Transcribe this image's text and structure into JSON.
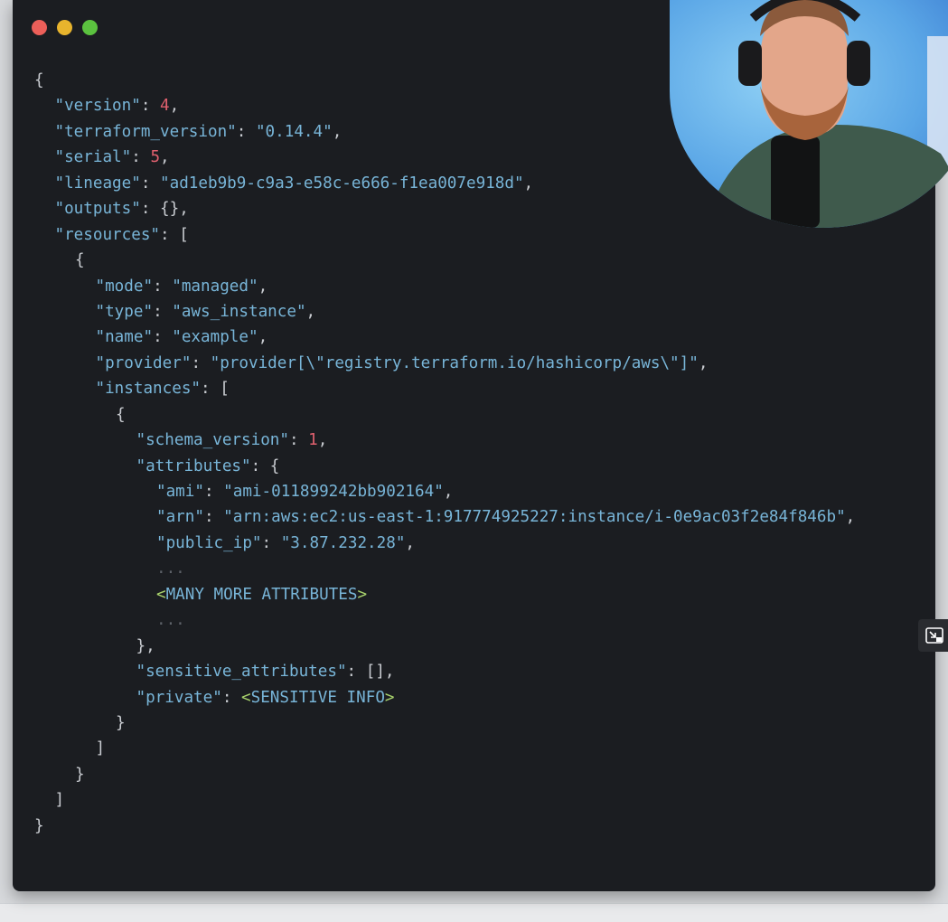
{
  "window": {
    "traffic_lights": [
      {
        "name": "close",
        "color": "#ec5f59"
      },
      {
        "name": "minimize",
        "color": "#e8b42d"
      },
      {
        "name": "maximize",
        "color": "#5bc23f"
      }
    ]
  },
  "colors": {
    "background": "#1b1d21",
    "key_string": "#78b5d8",
    "number": "#e0606e",
    "punctuation": "#c9ccd1",
    "placeholder_brackets": "#a8d26c",
    "ellipsis": "#5d6168"
  },
  "code": {
    "open_brace": "{",
    "version_key": "\"version\"",
    "version_val": "4",
    "tf_version_key": "\"terraform_version\"",
    "tf_version_val": "\"0.14.4\"",
    "serial_key": "\"serial\"",
    "serial_val": "5",
    "lineage_key": "\"lineage\"",
    "lineage_val": "\"ad1eb9b9-c9a3-e58c-e666-f1ea007e918d\"",
    "outputs_key": "\"outputs\"",
    "outputs_val": "{}",
    "resources_key": "\"resources\"",
    "open_bracket": "[",
    "mode_key": "\"mode\"",
    "mode_val": "\"managed\"",
    "type_key": "\"type\"",
    "type_val": "\"aws_instance\"",
    "name_key": "\"name\"",
    "name_val": "\"example\"",
    "provider_key": "\"provider\"",
    "provider_val": "\"provider[\\\"registry.terraform.io/hashicorp/aws\\\"]\"",
    "instances_key": "\"instances\"",
    "schema_version_key": "\"schema_version\"",
    "schema_version_val": "1",
    "attributes_key": "\"attributes\"",
    "ami_key": "\"ami\"",
    "ami_val": "\"ami-011899242bb902164\"",
    "arn_key": "\"arn\"",
    "arn_val": "\"arn:aws:ec2:us-east-1:917774925227:instance/i-0e9ac03f2e84f846b\"",
    "public_ip_key": "\"public_ip\"",
    "public_ip_val": "\"3.87.232.28\"",
    "ellipsis": "...",
    "many_more": "MANY MORE ATTRIBUTES",
    "close_attr": "},",
    "sensitive_key": "\"sensitive_attributes\"",
    "sensitive_val": "[]",
    "private_key": "\"private\"",
    "sensitive_info": "SENSITIVE INFO",
    "close_brace": "}",
    "close_bracket": "]"
  },
  "webcam": {
    "icon": "webcam-presenter"
  },
  "pip_button": {
    "icon": "picture-in-picture-icon"
  }
}
